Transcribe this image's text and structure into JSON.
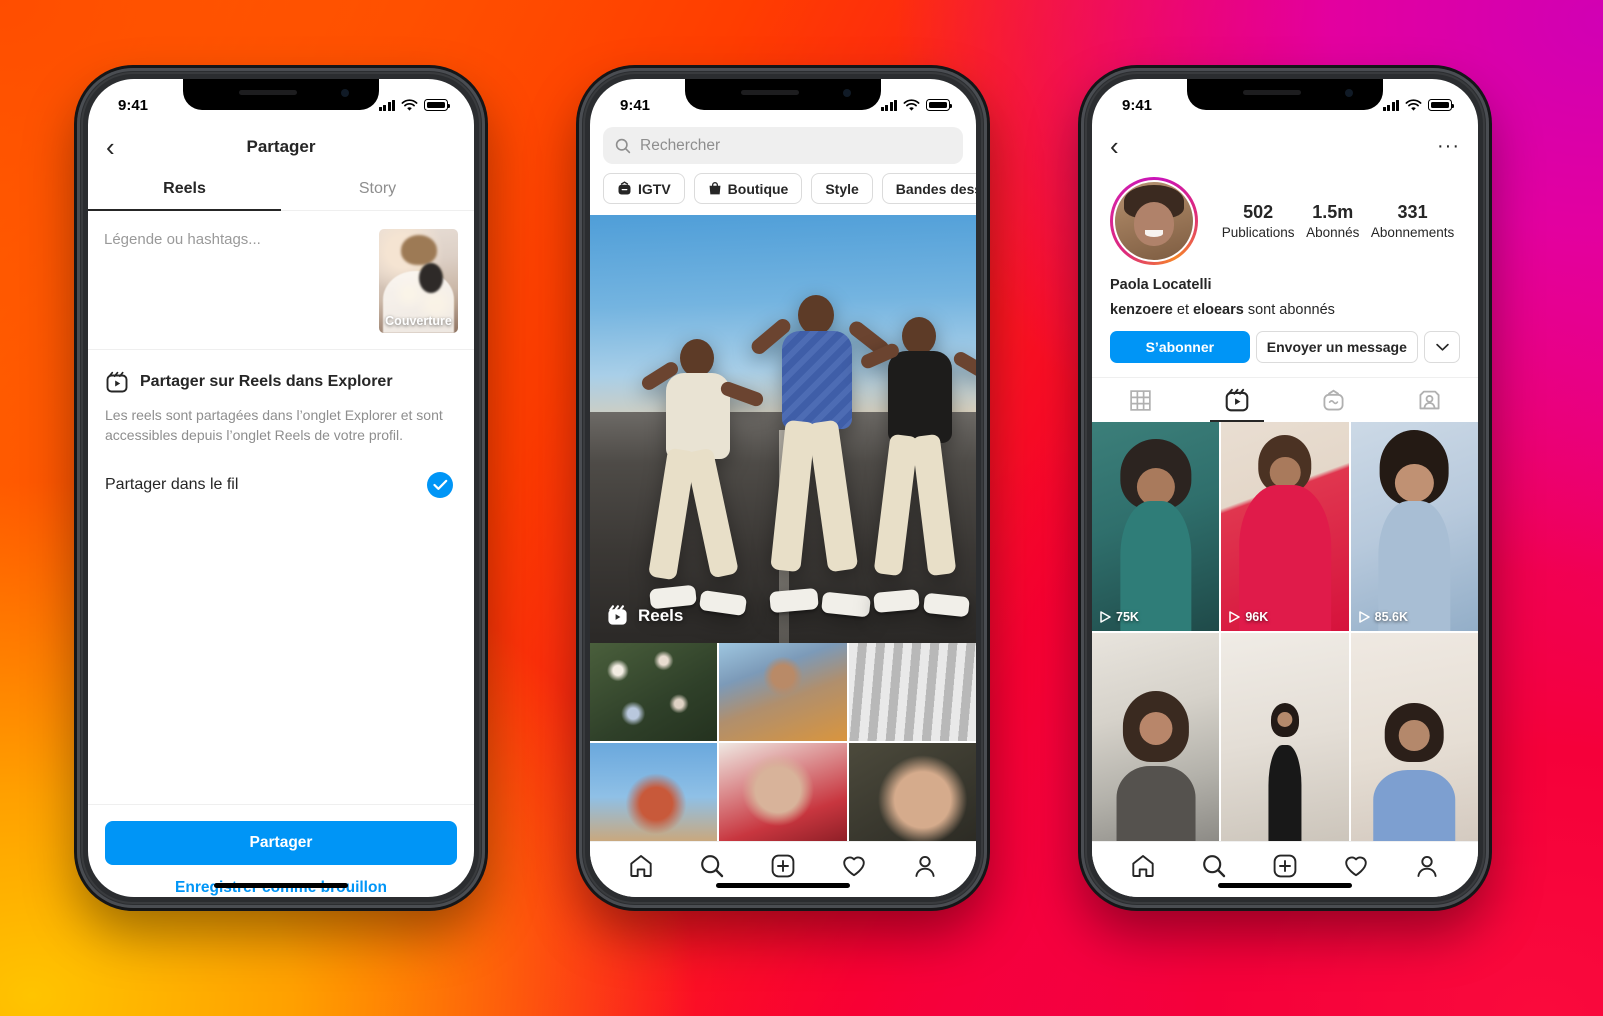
{
  "background": {
    "accent_orange": "#FF4D00",
    "accent_magenta": "#D100B4",
    "accent_crimson": "#F5003A",
    "accent_gold": "#FFC400"
  },
  "ig_blue": "#0095F6",
  "status_bar": {
    "time": "9:41"
  },
  "phone1": {
    "nav": {
      "back_icon": "chevron-left-icon",
      "title": "Partager"
    },
    "tabs": [
      {
        "label": "Reels",
        "active": true
      },
      {
        "label": "Story",
        "active": false
      }
    ],
    "caption_placeholder": "Légende ou hashtags...",
    "cover": {
      "label": "Couverture"
    },
    "section": {
      "icon": "reels-icon",
      "title": "Partager sur Reels dans Explorer",
      "description": "Les reels sont partagées dans l’onglet Explorer et sont accessibles depuis l’onglet Reels de votre profil."
    },
    "feed_row": {
      "label": "Partager dans le fil",
      "checked_icon": "check-circle-icon"
    },
    "buttons": {
      "primary": "Partager",
      "secondary": "Enregistrer comme brouillon"
    }
  },
  "phone2": {
    "search": {
      "placeholder": "Rechercher",
      "icon": "search-icon"
    },
    "pills": [
      {
        "label": "IGTV",
        "icon": "igtv-icon"
      },
      {
        "label": "Boutique",
        "icon": "shop-bag-icon"
      },
      {
        "label": "Style",
        "icon": ""
      },
      {
        "label": "Bandes dessinées",
        "icon": ""
      }
    ],
    "hero": {
      "badge": "Reels",
      "badge_icon": "reels-icon"
    },
    "nav": [
      {
        "name": "home",
        "icon": "home-icon"
      },
      {
        "name": "search",
        "icon": "search-icon"
      },
      {
        "name": "create",
        "icon": "plus-square-icon"
      },
      {
        "name": "activity",
        "icon": "heart-icon"
      },
      {
        "name": "profile",
        "icon": "person-icon"
      }
    ]
  },
  "phone3": {
    "nav": [
      {
        "name": "home",
        "icon": "home-icon"
      },
      {
        "name": "search",
        "icon": "search-icon"
      },
      {
        "name": "create",
        "icon": "plus-square-icon"
      },
      {
        "name": "activity",
        "icon": "heart-icon"
      },
      {
        "name": "profile",
        "icon": "person-icon"
      }
    ],
    "stats": [
      {
        "number": "502",
        "label": "Publications"
      },
      {
        "number": "1.5m",
        "label": "Abonnés"
      },
      {
        "number": "331",
        "label": "Abonnements"
      }
    ],
    "display_name": "Paola Locatelli",
    "followed_by": {
      "user1": "kenzoere",
      "conjunction": " et ",
      "user2": "eloears",
      "suffix": " sont abonnés"
    },
    "actions": {
      "follow": "S’abonner",
      "message": "Envoyer un message",
      "caret_icon": "chevron-down-icon"
    },
    "tabs": [
      {
        "name": "grid",
        "icon": "grid-icon",
        "active": false
      },
      {
        "name": "reels",
        "icon": "reels-icon",
        "active": true
      },
      {
        "name": "igtv",
        "icon": "igtv-icon",
        "active": false
      },
      {
        "name": "tagged",
        "icon": "tagged-icon",
        "active": false
      }
    ],
    "reels": [
      {
        "views": "75K"
      },
      {
        "views": "96K"
      },
      {
        "views": "85.6K"
      },
      {
        "views": ""
      },
      {
        "views": ""
      },
      {
        "views": ""
      }
    ]
  }
}
